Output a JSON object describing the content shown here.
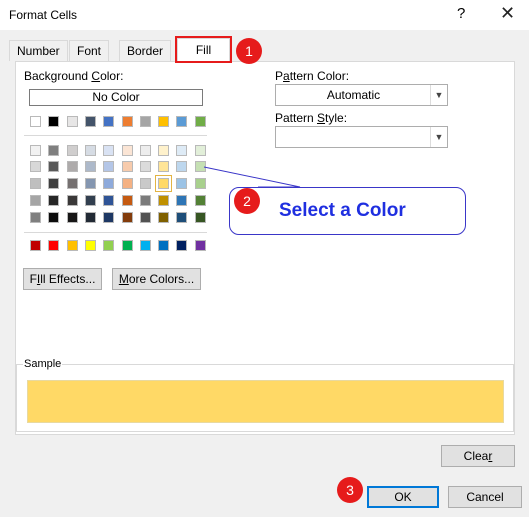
{
  "window": {
    "title": "Format Cells",
    "help_glyph": "?",
    "close_glyph": "✕"
  },
  "tabs": [
    {
      "label": "Number",
      "active": false
    },
    {
      "label": "Font",
      "active": false
    },
    {
      "label": "Border",
      "active": false
    },
    {
      "label": "Fill",
      "active": true
    }
  ],
  "fill": {
    "background_color_label_pre": "Background ",
    "background_color_label_key": "C",
    "background_color_label_post": "olor:",
    "no_color_label": "No Color",
    "theme_top_row": [
      "#ffffff",
      "#000000",
      "#e7e6e6",
      "#44546a",
      "#4472c4",
      "#ed7d31",
      "#a5a5a5",
      "#ffc000",
      "#5b9bd5",
      "#70ad47"
    ],
    "theme_shades": [
      [
        "#f2f2f2",
        "#7f7f7f",
        "#d0cece",
        "#d6dce4",
        "#d9e2f3",
        "#fbe5d5",
        "#ededed",
        "#fff2cc",
        "#deebf6",
        "#e2efd9"
      ],
      [
        "#d8d8d8",
        "#595959",
        "#aeabab",
        "#adb9ca",
        "#b4c6e7",
        "#f7cbac",
        "#dbdbdb",
        "#ffe598",
        "#bdd7ee",
        "#c5e0b3"
      ],
      [
        "#bfbfbf",
        "#3f3f3f",
        "#757070",
        "#8496b0",
        "#8eaadb",
        "#f4b183",
        "#c9c9c9",
        "#ffd966",
        "#9cc3e5",
        "#a8d08d"
      ],
      [
        "#a5a5a5",
        "#262626",
        "#3a3838",
        "#323f4f",
        "#2f5496",
        "#c55a11",
        "#7b7b7b",
        "#bf9000",
        "#2e75b5",
        "#538135"
      ],
      [
        "#7f7f7f",
        "#0c0c0c",
        "#171616",
        "#222a35",
        "#1e3864",
        "#833c0b",
        "#525252",
        "#7f6000",
        "#1e4e79",
        "#375623"
      ]
    ],
    "standard_colors": [
      "#c00000",
      "#ff0000",
      "#ffc000",
      "#ffff00",
      "#92d050",
      "#00b050",
      "#00b0f0",
      "#0070c0",
      "#002060",
      "#7030a0"
    ],
    "selected_color": "#ffd966",
    "fill_effects_label_key": "I",
    "fill_effects_label_post": "ll Effects...",
    "fill_effects_label_pre": "F",
    "more_colors_label_key": "M",
    "more_colors_label_post": "ore Colors...",
    "pattern_color_label_pre": "P",
    "pattern_color_label_key": "a",
    "pattern_color_label_post": "ttern Color:",
    "pattern_color_value": "Automatic",
    "pattern_style_label_pre": "Pattern ",
    "pattern_style_label_key": "S",
    "pattern_style_label_post": "tyle:",
    "pattern_style_value": "",
    "sample_label": "Sample",
    "sample_color": "#ffd966"
  },
  "footer": {
    "clear_label_pre": "Clea",
    "clear_label_key": "r",
    "ok_label": "OK",
    "cancel_label": "Cancel"
  },
  "annotations": {
    "badge_1": "1",
    "badge_2": "2",
    "badge_3": "3",
    "callout_text": "Select a Color",
    "accent_color": "#e61b1b",
    "callout_color": "#1f2fe0"
  }
}
